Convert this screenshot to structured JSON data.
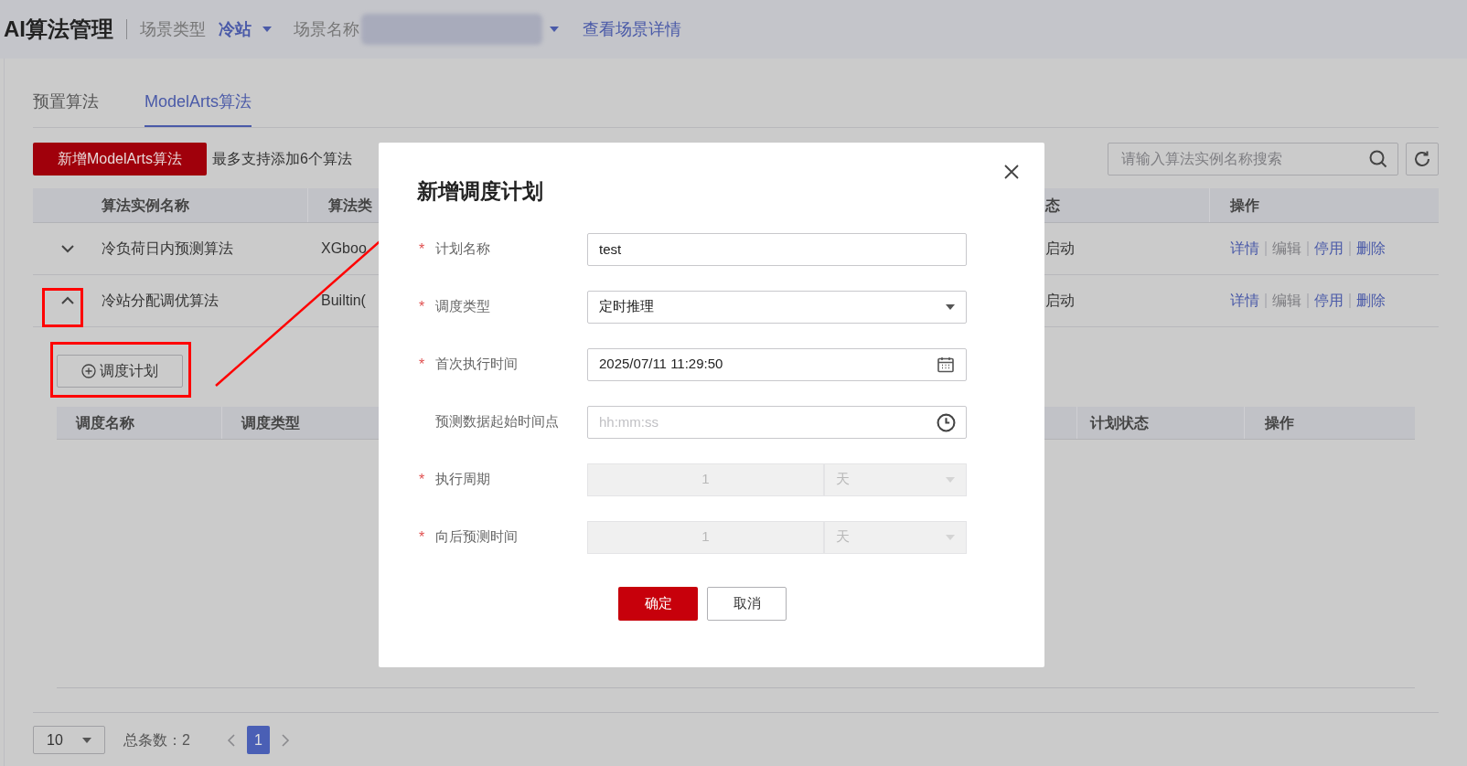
{
  "header": {
    "title": "AI算法管理",
    "scene_type_label": "场景类型",
    "scene_type_value": "冷站",
    "scene_name_label": "场景名称",
    "view_details_link": "查看场景详情"
  },
  "tabs": [
    {
      "label": "预置算法",
      "selected": false
    },
    {
      "label": "ModelArts算法",
      "selected": true
    }
  ],
  "toolbar": {
    "add_button": "新增ModelArts算法",
    "hint": "最多支持添加6个算法",
    "search": {
      "placeholder": "请输入算法实例名称搜索"
    }
  },
  "table": {
    "columns": [
      "算法实例名称",
      "算法类",
      "态",
      "操作"
    ],
    "rows": [
      {
        "expanded": false,
        "name": "冷负荷日内预测算法",
        "type": "XGboo",
        "status": "启动",
        "actions": [
          {
            "label": "详情",
            "disabled": false
          },
          {
            "label": "编辑",
            "disabled": true
          },
          {
            "label": "停用",
            "disabled": false
          },
          {
            "label": "删除",
            "disabled": false
          }
        ]
      },
      {
        "expanded": true,
        "name": "冷站分配调优算法",
        "type": "Builtin(",
        "status": "启动",
        "actions": [
          {
            "label": "详情",
            "disabled": false
          },
          {
            "label": "编辑",
            "disabled": true
          },
          {
            "label": "停用",
            "disabled": false
          },
          {
            "label": "删除",
            "disabled": false
          }
        ]
      }
    ]
  },
  "expanded_panel": {
    "add_schedule_button": "调度计划",
    "columns": [
      "调度名称",
      "调度类型",
      "计划状态",
      "操作"
    ]
  },
  "pagination": {
    "page_size": "10",
    "total": "总条数：2",
    "pages": [
      {
        "label": "1",
        "selected": true
      }
    ]
  },
  "dialog": {
    "title": "新增调度计划",
    "fields": [
      {
        "kind": "text",
        "label": "计划名称",
        "required": true,
        "value": "test"
      },
      {
        "kind": "select",
        "label": "调度类型",
        "required": true,
        "value": "定时推理"
      },
      {
        "kind": "date",
        "label": "首次执行时间",
        "required": true,
        "value": "2025/07/11 11:29:50"
      },
      {
        "kind": "time",
        "label": "预测数据起始时间点",
        "required": false,
        "placeholder": "hh:mm:ss"
      },
      {
        "kind": "period",
        "label": "执行周期",
        "required": true,
        "value": "1",
        "unit": "天",
        "disabled": true
      },
      {
        "kind": "period",
        "label": "向后预测时间",
        "required": true,
        "value": "1",
        "unit": "天",
        "disabled": true
      }
    ],
    "required_mark": "*",
    "confirm_button": "确定",
    "cancel_button": "取消"
  }
}
